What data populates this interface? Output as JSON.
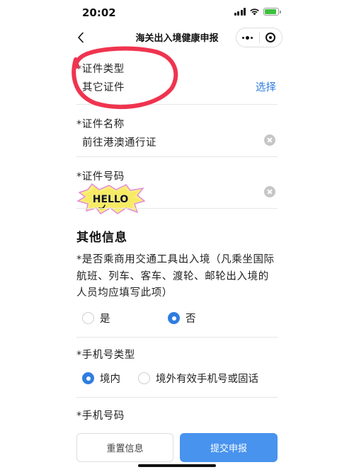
{
  "status": {
    "time": "20:02",
    "battery_level": 0.9,
    "battery_color": "#3cc13c"
  },
  "nav": {
    "title": "海关出入境健康申报",
    "back_icon": "chevron-left-icon",
    "more_icon": "more-dots-icon",
    "close_icon": "target-close-icon"
  },
  "form": {
    "cert_type": {
      "label": "*证件类型",
      "value": "其它证件",
      "action": "选择"
    },
    "cert_name": {
      "label": "*证件名称",
      "value": "前往港澳通行证"
    },
    "cert_number": {
      "label": "*证件号码",
      "sticker_text": "HELLO"
    }
  },
  "other_info": {
    "section_title": "其他信息",
    "transport_question": {
      "lines": [
        "*是否乘商用交通工具出入境（凡乘坐国际",
        "航班、列车、客车、渡轮、邮轮出入境的",
        "人员均应填写此项）"
      ],
      "options": [
        {
          "label": "是",
          "checked": false
        },
        {
          "label": "否",
          "checked": true
        }
      ]
    },
    "phone_type": {
      "label": "*手机号类型",
      "options": [
        {
          "label": "境内",
          "checked": true
        },
        {
          "label": "境外有效手机号或固话",
          "checked": false
        }
      ]
    },
    "phone_number": {
      "label": "*手机号码"
    }
  },
  "footer": {
    "reset_label": "重置信息",
    "submit_label": "提交申报"
  },
  "colors": {
    "accent": "#2f7de1",
    "submit_button": "#4893ee",
    "annotation_circle": "#f0344f"
  }
}
